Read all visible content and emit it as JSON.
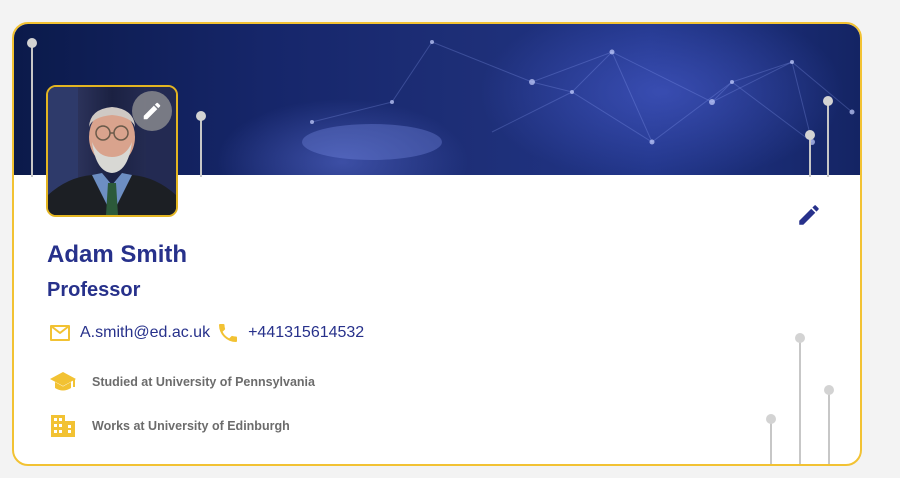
{
  "profile": {
    "name": "Adam Smith",
    "title": "Professor",
    "email": "A.smith@ed.ac.uk",
    "phone": "+441315614532",
    "education": "Studied at University of Pennsylvania",
    "work": "Works at University of Edinburgh"
  },
  "icons": {
    "avatar_edit": "pencil-icon",
    "profile_edit": "pencil-icon",
    "email": "mail-icon",
    "phone": "phone-icon",
    "education": "graduation-cap-icon",
    "work": "office-building-icon"
  },
  "colors": {
    "accent": "#f2c233",
    "name_text": "#27318b",
    "info_text": "#6c6c6c",
    "banner": "#1e2f78"
  }
}
